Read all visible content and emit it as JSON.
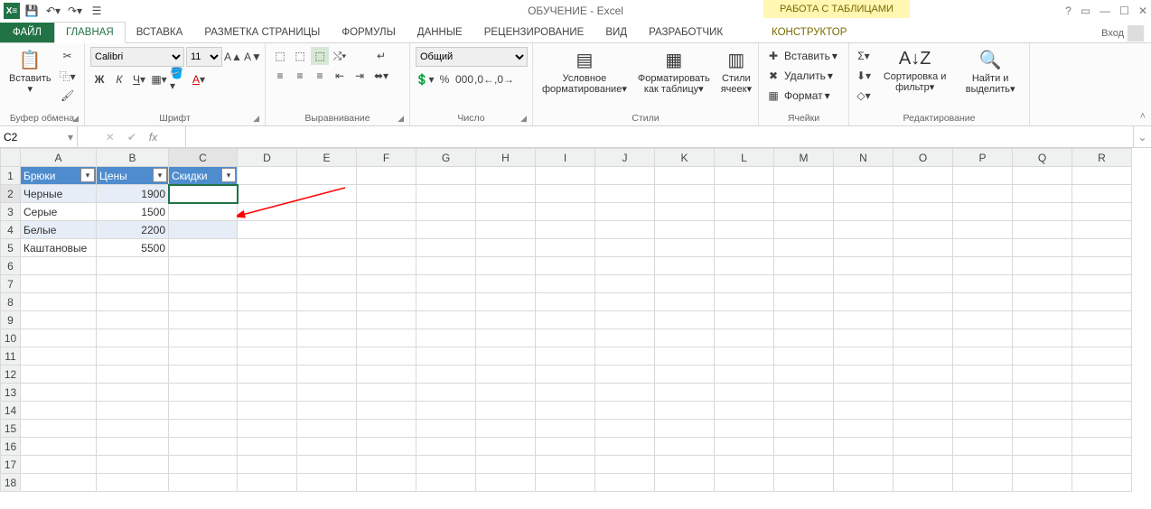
{
  "title": "ОБУЧЕНИЕ - Excel",
  "tabletools": "РАБОТА С ТАБЛИЦАМИ",
  "login": "Вход",
  "qat": {
    "save": "💾",
    "undo": "↶",
    "redo": "↷"
  },
  "tabs": {
    "file": "ФАЙЛ",
    "home": "ГЛАВНАЯ",
    "insert": "ВСТАВКА",
    "layout": "РАЗМЕТКА СТРАНИЦЫ",
    "formulas": "ФОРМУЛЫ",
    "data": "ДАННЫЕ",
    "review": "РЕЦЕНЗИРОВАНИЕ",
    "view": "ВИД",
    "dev": "РАЗРАБОТЧИК",
    "design": "КОНСТРУКТОР"
  },
  "groups": {
    "clipboard": "Буфер обмена",
    "font": "Шрифт",
    "align": "Выравнивание",
    "number": "Число",
    "styles": "Стили",
    "cells": "Ячейки",
    "editing": "Редактирование"
  },
  "font": {
    "name": "Calibri",
    "size": "11"
  },
  "number": {
    "format": "Общий"
  },
  "clipboard": {
    "paste": "Вставить"
  },
  "styles": {
    "cond": "Условное форматирование",
    "astable": "Форматировать как таблицу",
    "cell": "Стили ячеек"
  },
  "cells": {
    "insert": "Вставить",
    "delete": "Удалить",
    "format": "Формат"
  },
  "editing": {
    "sort": "Сортировка и фильтр",
    "find": "Найти и выделить"
  },
  "namebox": "C2",
  "columns": [
    "A",
    "B",
    "C",
    "D",
    "E",
    "F",
    "G",
    "H",
    "I",
    "J",
    "K",
    "L",
    "M",
    "N",
    "O",
    "P",
    "Q",
    "R"
  ],
  "table": {
    "headers": [
      "Брюки",
      "Цены",
      "Скидки"
    ],
    "rows": [
      {
        "a": "Черные",
        "b": "1900",
        "c": ""
      },
      {
        "a": "Серые",
        "b": "1500",
        "c": ""
      },
      {
        "a": "Белые",
        "b": "2200",
        "c": ""
      },
      {
        "a": "Каштановые",
        "b": "5500",
        "c": ""
      }
    ]
  }
}
